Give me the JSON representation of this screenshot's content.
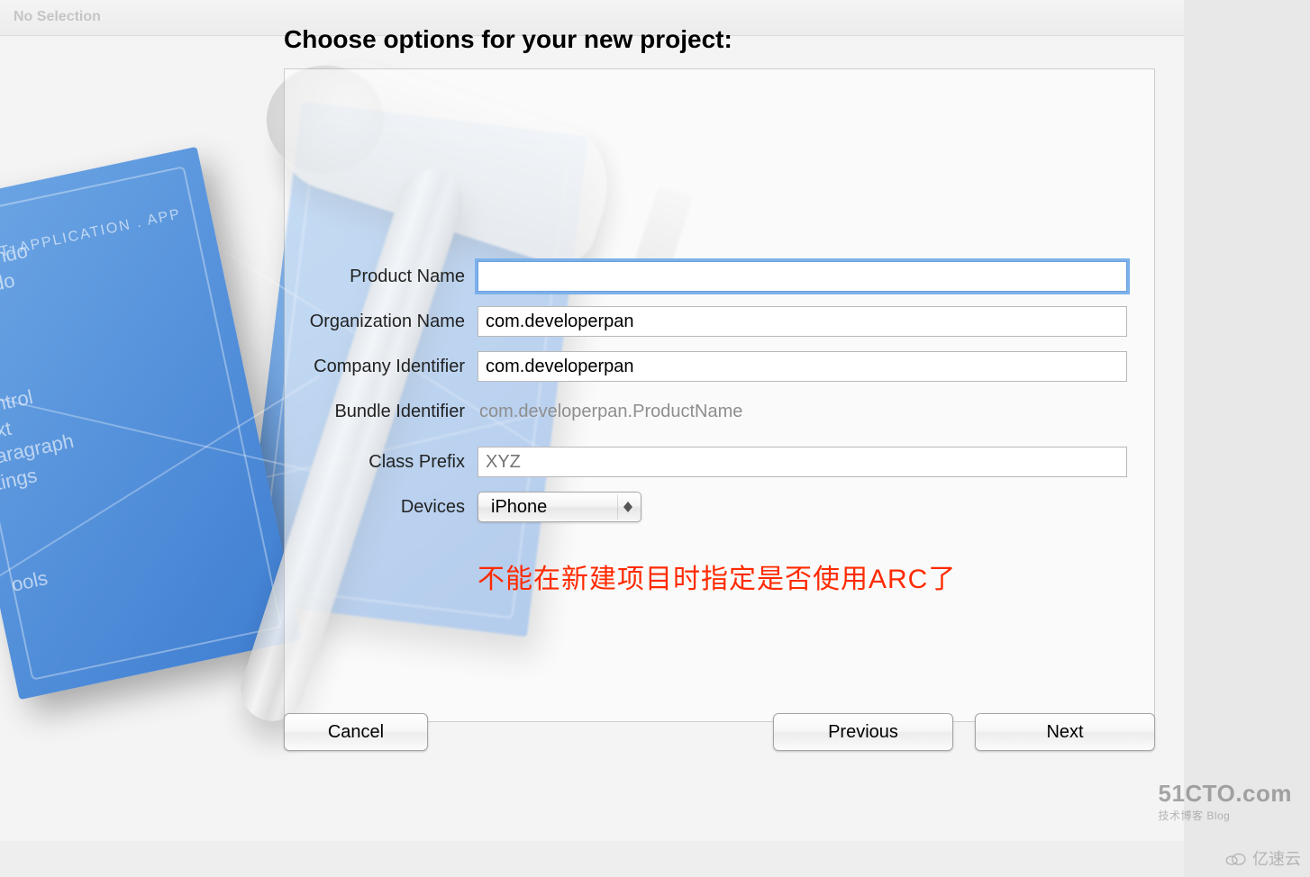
{
  "header": {
    "no_selection": "No Selection"
  },
  "dialog": {
    "title": "Choose options for your new project:",
    "annotation": "不能在新建项目时指定是否使用ARC了"
  },
  "form": {
    "product_name_label": "Product Name",
    "product_name_value": "",
    "organization_name_label": "Organization Name",
    "organization_name_value": "com.developerpan",
    "company_identifier_label": "Company Identifier",
    "company_identifier_value": "com.developerpan",
    "bundle_identifier_label": "Bundle Identifier",
    "bundle_identifier_value": "com.developerpan.ProductName",
    "class_prefix_label": "Class Prefix",
    "class_prefix_placeholder": "XYZ",
    "class_prefix_value": "",
    "devices_label": "Devices",
    "devices_value": "iPhone"
  },
  "buttons": {
    "cancel": "Cancel",
    "previous": "Previous",
    "next": "Next"
  },
  "watermarks": {
    "cto_domain": "51CTO.com",
    "cto_sub": "技术博客  Blog",
    "yisu": "亿速云"
  }
}
